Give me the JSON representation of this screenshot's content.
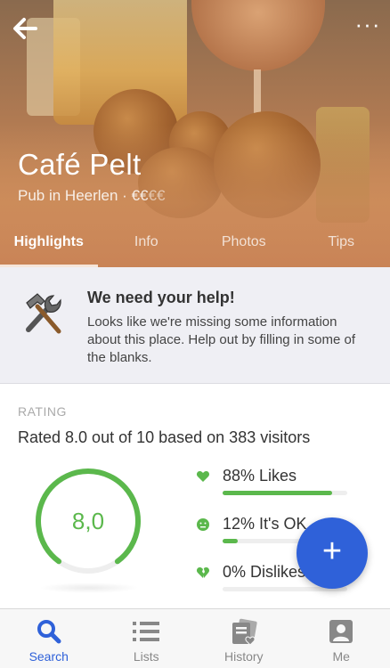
{
  "venue": {
    "name": "Café Pelt",
    "category_location": "Pub in Heerlen · ",
    "price_active": "€€",
    "price_inactive": "€€"
  },
  "tabs": [
    {
      "label": "Highlights",
      "active": true
    },
    {
      "label": "Info",
      "active": false
    },
    {
      "label": "Photos",
      "active": false
    },
    {
      "label": "Tips",
      "active": false
    }
  ],
  "help_banner": {
    "title": "We need your help!",
    "text": "Looks like we're missing some information about this place. Help out by filling in some of the blanks.",
    "icon": "tools-icon"
  },
  "rating": {
    "section_label": "RATING",
    "summary": "Rated 8.0 out of 10 based on 383 visitors",
    "value_display": "8,0",
    "value": 8.0,
    "max": 10,
    "color": "#5bb84c",
    "breakdown": [
      {
        "label": "88% Likes",
        "percent": 88,
        "icon": "heart-icon"
      },
      {
        "label": "12% It's OK",
        "percent": 12,
        "icon": "meh-face-icon"
      },
      {
        "label": "0% Dislikes",
        "percent": 0,
        "icon": "broken-heart-icon"
      }
    ]
  },
  "fab": {
    "icon": "plus-icon",
    "label": "+"
  },
  "header": {
    "back_icon": "back-arrow-icon",
    "more_icon": "more-icon",
    "more_label": "···"
  },
  "bottom_nav": [
    {
      "label": "Search",
      "icon": "search-icon",
      "active": true
    },
    {
      "label": "Lists",
      "icon": "list-icon",
      "active": false
    },
    {
      "label": "History",
      "icon": "history-icon",
      "active": false
    },
    {
      "label": "Me",
      "icon": "profile-icon",
      "active": false
    }
  ],
  "colors": {
    "accent": "#2f61d9",
    "positive": "#5bb84c"
  }
}
